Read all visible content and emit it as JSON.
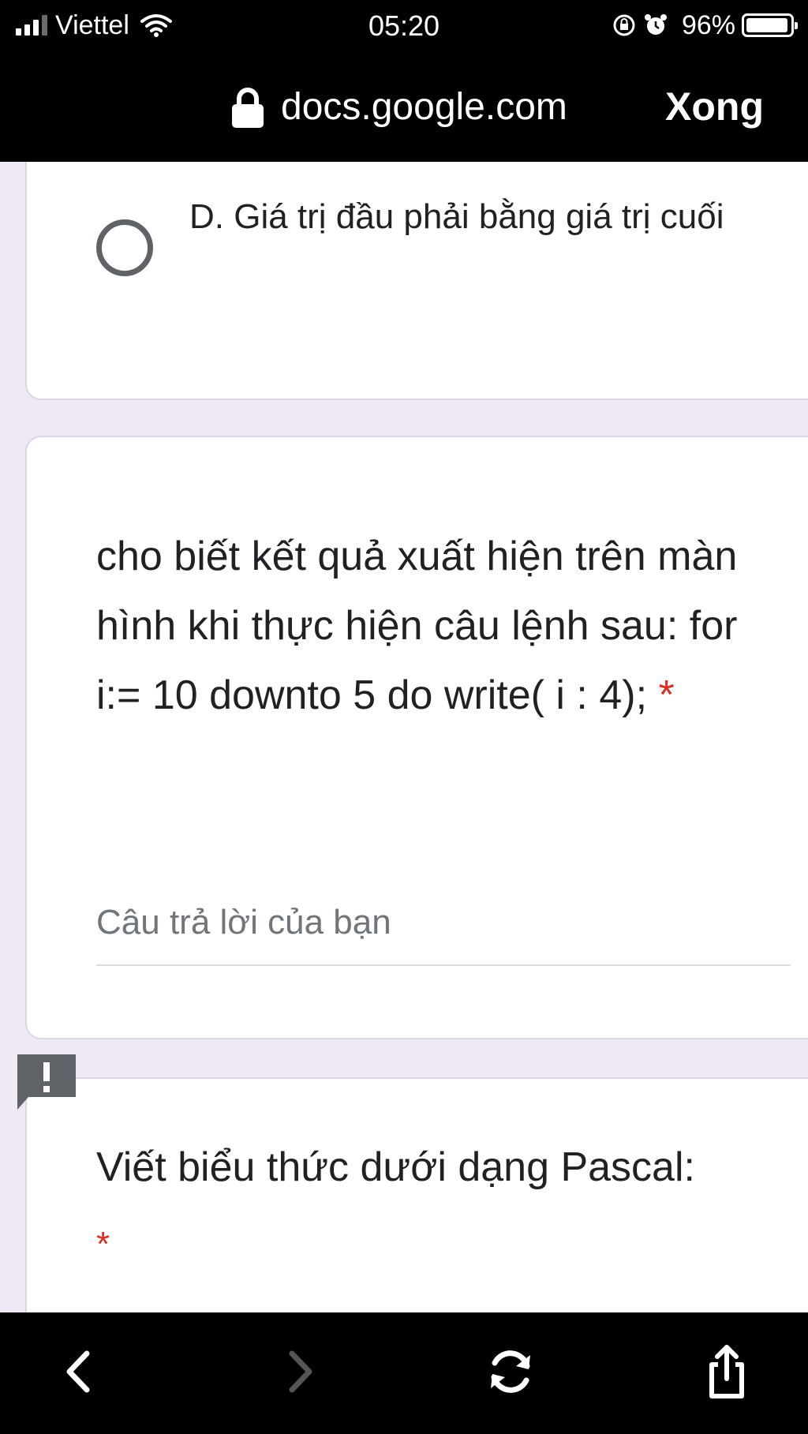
{
  "status_bar": {
    "carrier": "Viettel",
    "time": "05:20",
    "battery_percent": "96%",
    "battery_level": 0.96,
    "signal_bars_active": 3,
    "signal_bars_total": 4
  },
  "browser": {
    "url": "docs.google.com",
    "done_label": "Xong"
  },
  "form": {
    "option_d": {
      "label": "D. Giá trị đầu phải bằng giá trị cuối",
      "selected": false
    },
    "question_2": {
      "title": "cho biết kết quả xuất hiện trên màn hình khi thực hiện câu lệnh sau: for i:= 10 downto 5 do write( i : 4);",
      "required_mark": "*",
      "answer_placeholder": "Câu trả lời của bạn",
      "answer_value": ""
    },
    "question_3": {
      "title": "Viết biểu thức dưới dạng Pascal:",
      "required_mark": "*"
    }
  },
  "colors": {
    "page_background": "#efe9f6",
    "card_background": "#ffffff",
    "required": "#d93025",
    "radio_border": "#5f6368",
    "placeholder": "#70757a",
    "feedback_icon": "#5f6368"
  },
  "icons": {
    "status": [
      "signal-icon",
      "wifi-icon",
      "rotation-lock-icon",
      "alarm-icon",
      "battery-icon"
    ],
    "browser": [
      "lock-icon"
    ],
    "toolbar": [
      "back-icon",
      "forward-icon",
      "reload-icon",
      "share-icon"
    ],
    "form": [
      "feedback-icon"
    ]
  }
}
